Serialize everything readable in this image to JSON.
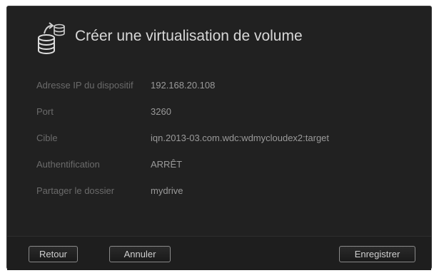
{
  "dialog": {
    "title": "Créer une virtualisation de volume",
    "icon": "database-share-icon"
  },
  "fields": [
    {
      "label": "Adresse IP du dispositif",
      "value": "192.168.20.108"
    },
    {
      "label": "Port",
      "value": "3260"
    },
    {
      "label": "Cible",
      "value": "iqn.2013-03.com.wdc:wdmycloudex2:target"
    },
    {
      "label": "Authentification",
      "value": "ARRÊT"
    },
    {
      "label": "Partager le dossier",
      "value": "mydrive"
    }
  ],
  "buttons": {
    "back": "Retour",
    "cancel": "Annuler",
    "save": "Enregistrer"
  },
  "colors": {
    "background": "#212121",
    "label": "#6b6b6b",
    "value": "#9a9a9a",
    "title": "#d8d8d8"
  }
}
